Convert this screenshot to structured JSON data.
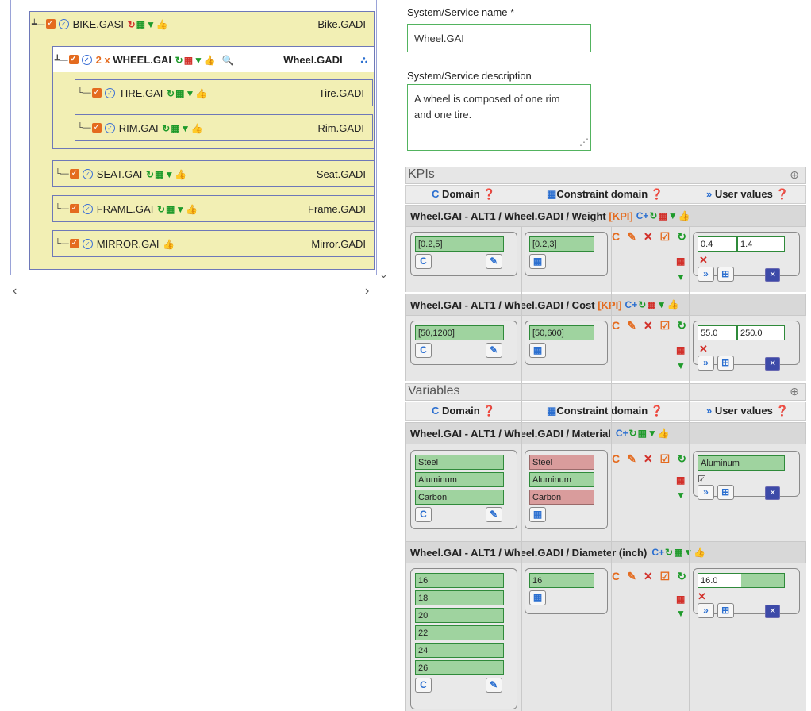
{
  "tree": {
    "bike": {
      "name": "BIKE.GASI",
      "gadi": "Bike.GADI"
    },
    "wheel": {
      "prefix": "2 x",
      "name": "WHEEL.GAI",
      "gadi": "Wheel.GADI"
    },
    "tire": {
      "name": "TIRE.GAI",
      "gadi": "Tire.GADI"
    },
    "rim": {
      "name": "RIM.GAI",
      "gadi": "Rim.GADI"
    },
    "seat": {
      "name": "SEAT.GAI",
      "gadi": "Seat.GADI"
    },
    "frame": {
      "name": "FRAME.GAI",
      "gadi": "Frame.GADI"
    },
    "mirror": {
      "name": "MIRROR.GAI",
      "gadi": "Mirror.GADI"
    }
  },
  "form": {
    "name_label": "System/Service name",
    "name_required": "*",
    "name_value": "Wheel.GAI",
    "desc_label": "System/Service description",
    "desc_value": "A wheel is composed of one rim and one tire."
  },
  "kpis": {
    "title": "KPIs",
    "col_domain": "Domain",
    "col_constraint": "Constraint domain",
    "col_user": "User values",
    "rows": [
      {
        "path": "Wheel.GAI - ALT1 / Wheel.GADI / Weight",
        "tag": "[KPI]",
        "domain": "[0.2,5]",
        "constraint": "[0.2,3]",
        "user_min": "0.4",
        "user_max": "1.4"
      },
      {
        "path": "Wheel.GAI - ALT1 / Wheel.GADI / Cost",
        "tag": "[KPI]",
        "domain": "[50,1200]",
        "constraint": "[50,600]",
        "user_min": "55.0",
        "user_max": "250.0"
      }
    ]
  },
  "variables": {
    "title": "Variables",
    "col_domain": "Domain",
    "col_constraint": "Constraint domain",
    "col_user": "User values",
    "material": {
      "path": "Wheel.GAI - ALT1 / Wheel.GADI / Material",
      "domain": [
        "Steel",
        "Aluminum",
        "Carbon"
      ],
      "constraint": [
        "Steel",
        "Aluminum",
        "Carbon"
      ],
      "user": "Aluminum"
    },
    "diameter": {
      "path": "Wheel.GAI - ALT1 / Wheel.GADI / Diameter (inch)",
      "domain": [
        "16",
        "18",
        "20",
        "22",
        "24",
        "26"
      ],
      "constraint": [
        "16"
      ],
      "user": "16.0"
    }
  },
  "icons": {
    "checkbox": "check-icon",
    "circle_check": "circle-check-icon",
    "refresh": "refresh-icon",
    "calc": "calculator-icon",
    "filter": "filter-icon",
    "thumb": "thumbs-up-icon",
    "search": "search-icon",
    "hierarchy": "hierarchy-icon",
    "help": "help-icon"
  },
  "colors": {
    "accent_green": "#1e9a2a",
    "accent_orange": "#e46b1f",
    "accent_blue": "#2b6fd0",
    "tree_bg": "#f2efb4",
    "value_green": "#9fd39f",
    "value_red": "#d99c9c"
  }
}
